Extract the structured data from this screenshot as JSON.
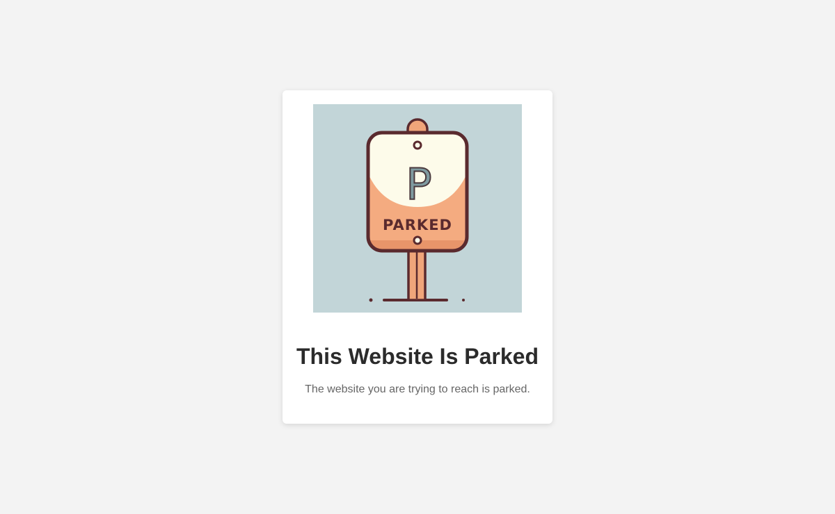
{
  "card": {
    "title": "This Website Is Parked",
    "message": "The website you are trying to reach is parked."
  },
  "illustration": {
    "icon": "parking-sign-icon",
    "sign_letter": "P",
    "sign_text": "PARKED",
    "colors": {
      "background": "#c2d5d8",
      "outline": "#5a2a2e",
      "sign_top": "#fdfbea",
      "sign_bottom": "#f4ab80",
      "letter": "#7f9aa0",
      "post": "#f0a57a"
    }
  }
}
